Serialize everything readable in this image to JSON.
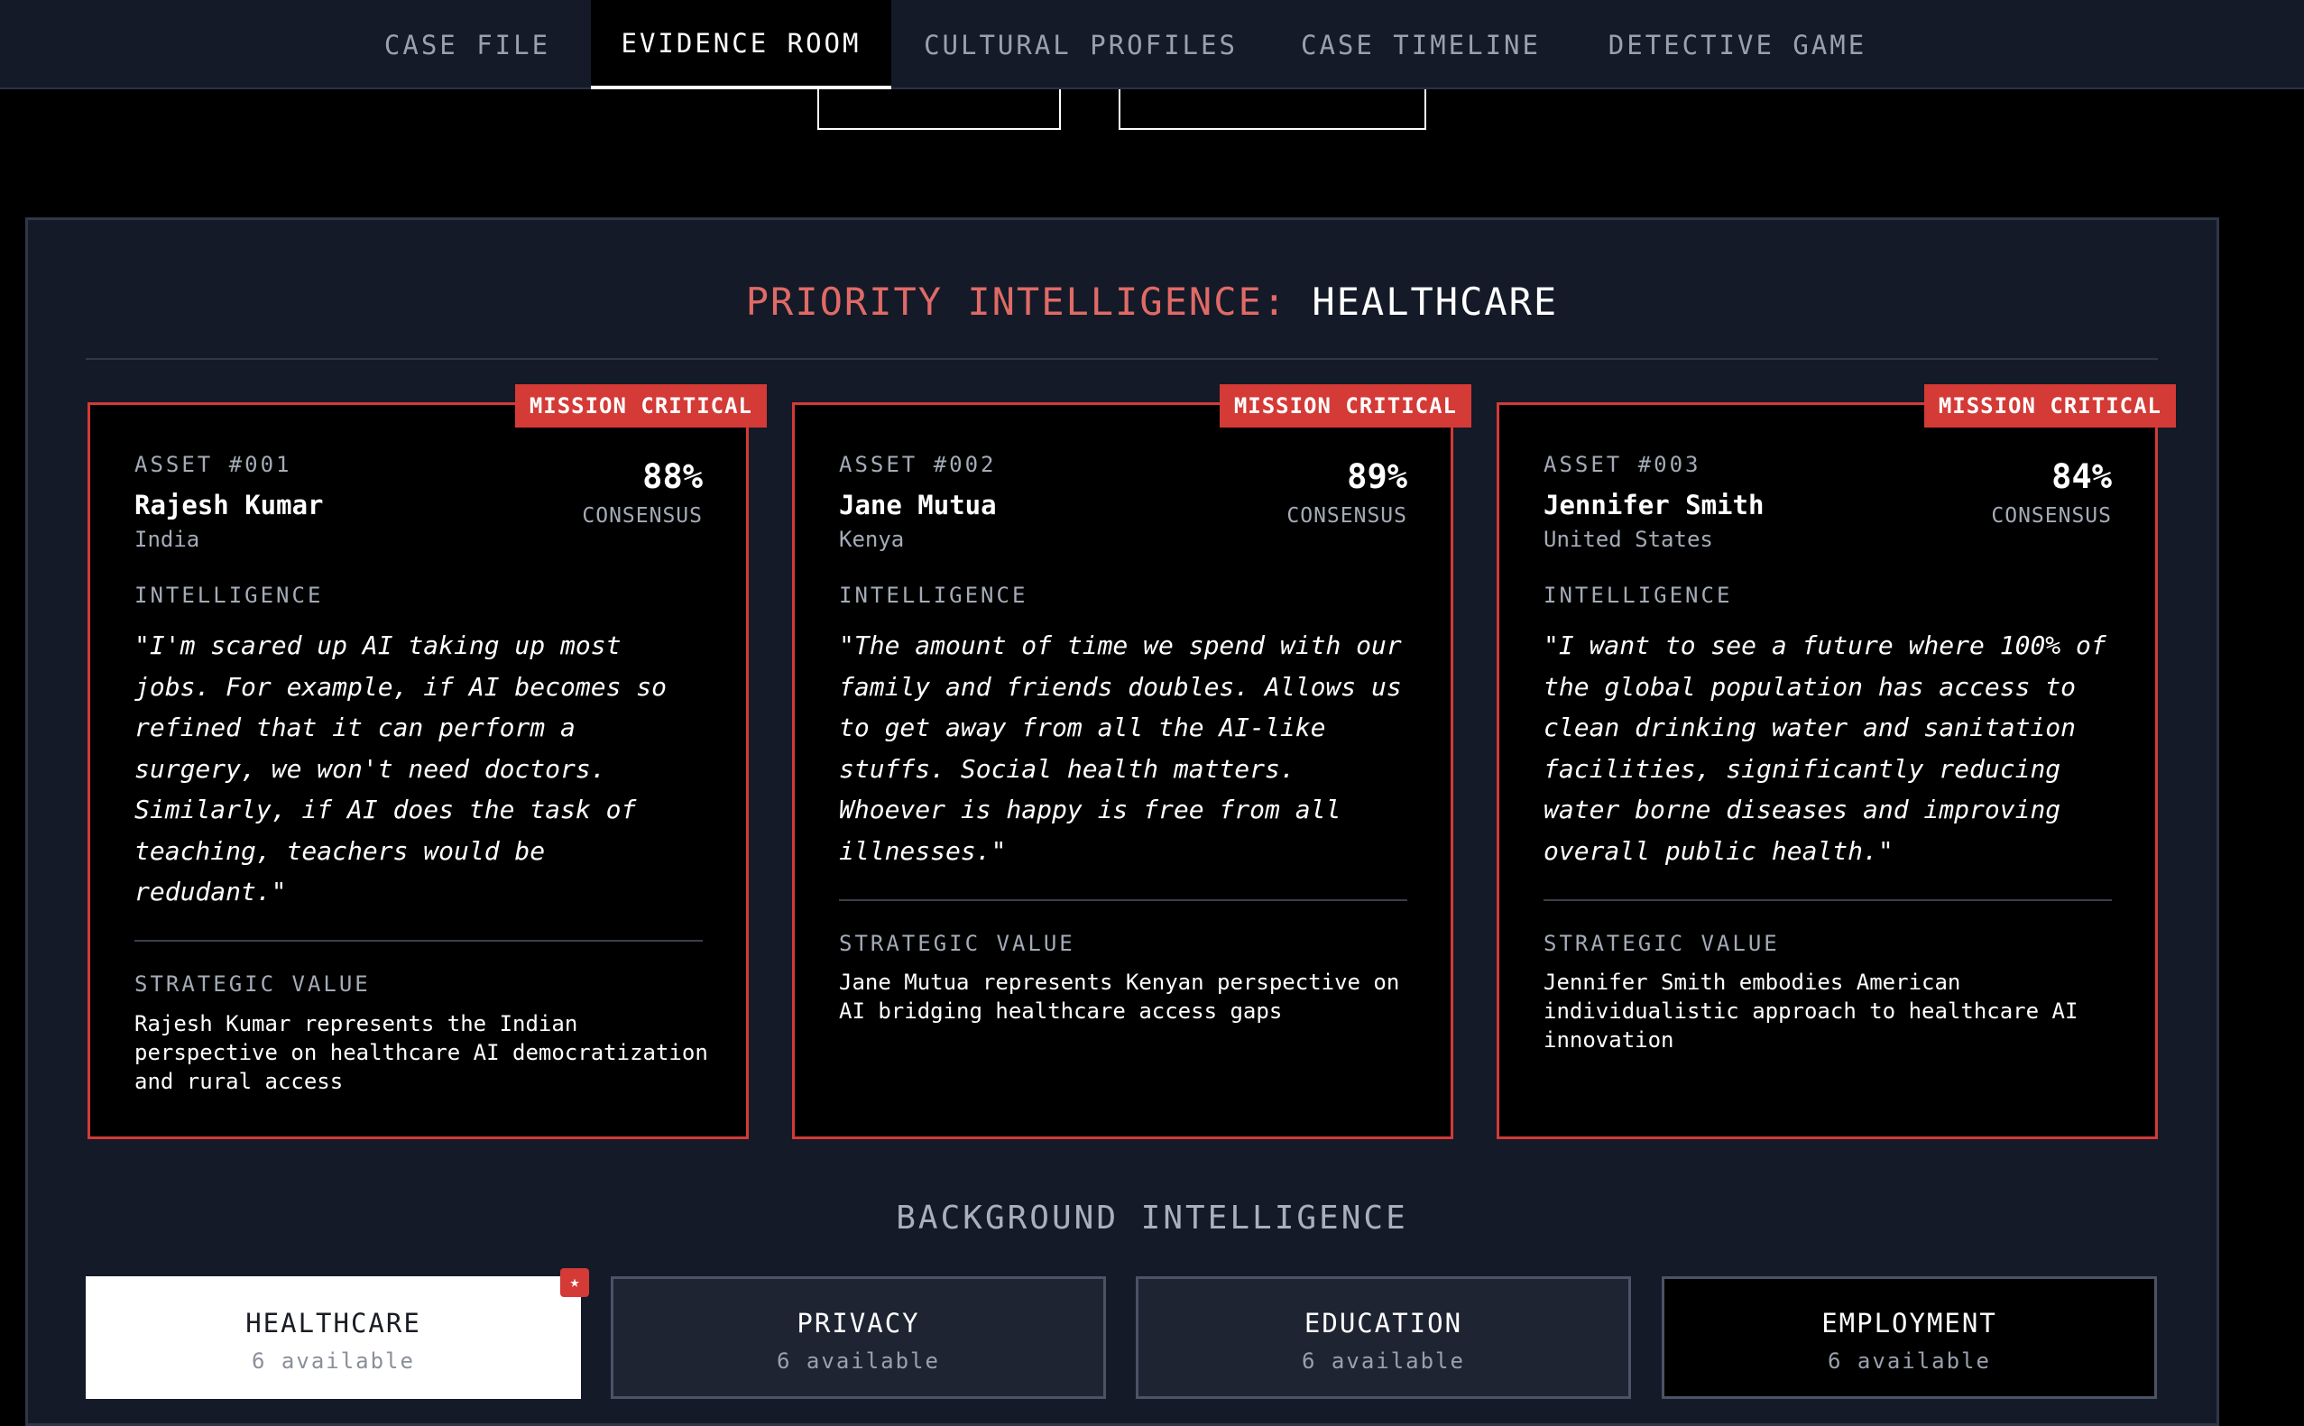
{
  "nav": {
    "tabs": [
      {
        "label": "CASE FILE"
      },
      {
        "label": "EVIDENCE ROOM"
      },
      {
        "label": "CULTURAL PROFILES"
      },
      {
        "label": "CASE TIMELINE"
      },
      {
        "label": "DETECTIVE GAME"
      }
    ],
    "active_tab": "EVIDENCE ROOM"
  },
  "priority": {
    "prefix": "PRIORITY INTELLIGENCE:",
    "topic": "HEALTHCARE"
  },
  "assets": [
    {
      "badge": "MISSION CRITICAL",
      "id": "ASSET #001",
      "name": "Rajesh Kumar",
      "country": "India",
      "consensus": "88%",
      "consensus_label": "CONSENSUS",
      "intelligence_label": "INTELLIGENCE",
      "quote": "\"I'm scared up AI taking up most jobs. For example, if AI becomes so refined that it can perform a surgery, we won't need doctors. Similarly, if AI does the task of teaching, teachers would be redudant.\"",
      "strategic_label": "STRATEGIC VALUE",
      "strategic_value": "Rajesh Kumar represents the Indian perspective on healthcare AI democratization and rural access"
    },
    {
      "badge": "MISSION CRITICAL",
      "id": "ASSET #002",
      "name": "Jane Mutua",
      "country": "Kenya",
      "consensus": "89%",
      "consensus_label": "CONSENSUS",
      "intelligence_label": "INTELLIGENCE",
      "quote": "\"The amount of time we spend with our family and friends doubles. Allows us to get away from all the AI-like stuffs. Social health matters. Whoever is happy is free from all illnesses.\"",
      "strategic_label": "STRATEGIC VALUE",
      "strategic_value": "Jane Mutua represents Kenyan perspective on AI bridging healthcare access gaps"
    },
    {
      "badge": "MISSION CRITICAL",
      "id": "ASSET #003",
      "name": "Jennifer Smith",
      "country": "United States",
      "consensus": "84%",
      "consensus_label": "CONSENSUS",
      "intelligence_label": "INTELLIGENCE",
      "quote": "\"I want to see a future where 100% of the global population has access to clean drinking water and sanitation facilities, significantly reducing water borne diseases and improving overall public health.\"",
      "strategic_label": "STRATEGIC VALUE",
      "strategic_value": "Jennifer Smith embodies American individualistic approach to healthcare AI innovation"
    }
  ],
  "background": {
    "title": "BACKGROUND INTELLIGENCE",
    "categories": [
      {
        "name": "HEALTHCARE",
        "count": "6 available",
        "star": "★"
      },
      {
        "name": "PRIVACY",
        "count": "6 available"
      },
      {
        "name": "EDUCATION",
        "count": "6 available"
      },
      {
        "name": "EMPLOYMENT",
        "count": "6 available"
      }
    ],
    "selected": "HEALTHCARE"
  },
  "colors": {
    "accent_red": "#d43a36",
    "title_red": "#e06a66",
    "panel_bg": "#141a28",
    "nav_bg": "#141a28"
  }
}
